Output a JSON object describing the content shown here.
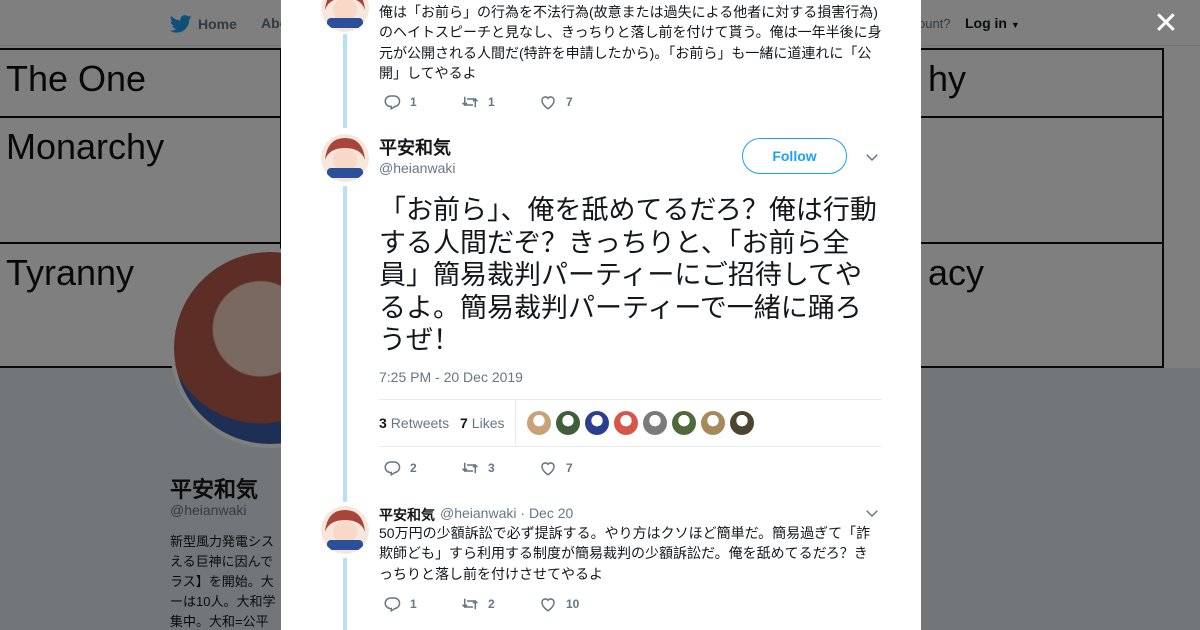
{
  "background": {
    "nav": {
      "home_label": "Home",
      "about_label": "Abo",
      "account_text": "ccount?",
      "login_label": "Log in"
    },
    "banner_cells": [
      {
        "label": "The One"
      },
      {
        "label": "Monarchy"
      },
      {
        "label": "Tyranny"
      },
      {
        "label": "hy"
      },
      {
        "label": "acy"
      }
    ],
    "profile": {
      "name": "平安和気",
      "handle": "@heianwaki",
      "bio": "新型風力発電シスえる巨神に因んでラス】を開始。大ーは10人。大和学集中。大和=公平"
    }
  },
  "modal": {
    "close_icon": "close-icon",
    "prev_tweet": {
      "text": "俺は「お前ら」の行為を不法行為(故意または過失による他者に対する損害行為)のヘイトスピーチと見なし、きっちりと落し前を付けて貰う。俺は一年半後に身元が公開される人間だ(特許を申請したから)。「お前ら」も一緒に道連れに「公開」してやるよ",
      "replies": "1",
      "retweets": "1",
      "likes": "7"
    },
    "main_tweet": {
      "name": "平安和気",
      "handle": "@heianwaki",
      "follow_label": "Follow",
      "text": "「お前ら」、俺を舐めてるだろ？俺は行動する人間だぞ？きっちりと、「お前ら全員」簡易裁判パーティーにご招待してやるよ。簡易裁判パーティーで一緒に踊ろうぜ！",
      "timestamp": "7:25 PM - 20 Dec 2019",
      "retweet_count": "3",
      "retweet_label": "Retweets",
      "like_count": "7",
      "like_label": "Likes",
      "likers": [
        "#c9a27a",
        "#3f5f3a",
        "#2b3f8f",
        "#d7564a",
        "#7b7b7b",
        "#4f6b3a",
        "#a88a5a",
        "#4b4631"
      ],
      "replies": "2",
      "retweets": "3",
      "likes": "7"
    },
    "reply_tweet": {
      "name": "平安和気",
      "handle": "@heianwaki",
      "separator": "·",
      "date": "Dec 20",
      "text": "50万円の少額訴訟で必ず提訴する。やり方はクソほど簡単だ。簡易過ぎて「詐欺師ども」すら利用する制度が簡易裁判の少額訴訟だ。俺を舐めてるだろ？きっちりと落し前を付けさせてやるよ",
      "replies": "1",
      "retweets": "2",
      "likes": "10"
    }
  },
  "colors": {
    "accent": "#1da1f2",
    "thread_line": "#b7dff6",
    "secondary_text": "#657786",
    "primary_text": "#14171a"
  }
}
